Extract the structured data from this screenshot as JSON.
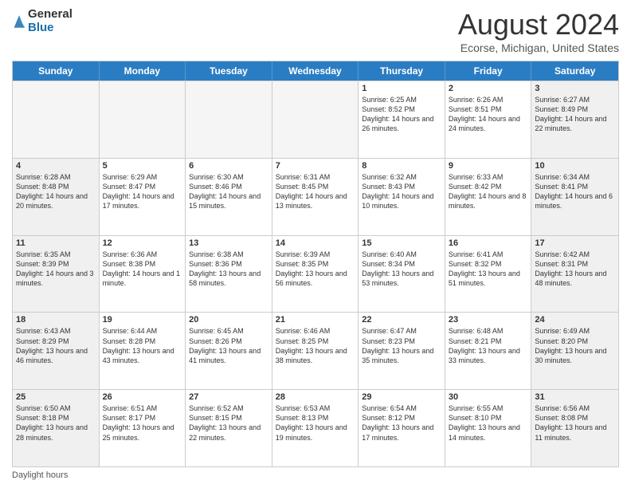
{
  "logo": {
    "general": "General",
    "blue": "Blue"
  },
  "title": "August 2024",
  "location": "Ecorse, Michigan, United States",
  "days_of_week": [
    "Sunday",
    "Monday",
    "Tuesday",
    "Wednesday",
    "Thursday",
    "Friday",
    "Saturday"
  ],
  "footer": "Daylight hours",
  "weeks": [
    [
      {
        "day": "",
        "text": "",
        "empty": true
      },
      {
        "day": "",
        "text": "",
        "empty": true
      },
      {
        "day": "",
        "text": "",
        "empty": true
      },
      {
        "day": "",
        "text": "",
        "empty": true
      },
      {
        "day": "1",
        "text": "Sunrise: 6:25 AM\nSunset: 8:52 PM\nDaylight: 14 hours and 26 minutes.",
        "empty": false
      },
      {
        "day": "2",
        "text": "Sunrise: 6:26 AM\nSunset: 8:51 PM\nDaylight: 14 hours and 24 minutes.",
        "empty": false
      },
      {
        "day": "3",
        "text": "Sunrise: 6:27 AM\nSunset: 8:49 PM\nDaylight: 14 hours and 22 minutes.",
        "empty": false
      }
    ],
    [
      {
        "day": "4",
        "text": "Sunrise: 6:28 AM\nSunset: 8:48 PM\nDaylight: 14 hours and 20 minutes.",
        "empty": false
      },
      {
        "day": "5",
        "text": "Sunrise: 6:29 AM\nSunset: 8:47 PM\nDaylight: 14 hours and 17 minutes.",
        "empty": false
      },
      {
        "day": "6",
        "text": "Sunrise: 6:30 AM\nSunset: 8:46 PM\nDaylight: 14 hours and 15 minutes.",
        "empty": false
      },
      {
        "day": "7",
        "text": "Sunrise: 6:31 AM\nSunset: 8:45 PM\nDaylight: 14 hours and 13 minutes.",
        "empty": false
      },
      {
        "day": "8",
        "text": "Sunrise: 6:32 AM\nSunset: 8:43 PM\nDaylight: 14 hours and 10 minutes.",
        "empty": false
      },
      {
        "day": "9",
        "text": "Sunrise: 6:33 AM\nSunset: 8:42 PM\nDaylight: 14 hours and 8 minutes.",
        "empty": false
      },
      {
        "day": "10",
        "text": "Sunrise: 6:34 AM\nSunset: 8:41 PM\nDaylight: 14 hours and 6 minutes.",
        "empty": false
      }
    ],
    [
      {
        "day": "11",
        "text": "Sunrise: 6:35 AM\nSunset: 8:39 PM\nDaylight: 14 hours and 3 minutes.",
        "empty": false
      },
      {
        "day": "12",
        "text": "Sunrise: 6:36 AM\nSunset: 8:38 PM\nDaylight: 14 hours and 1 minute.",
        "empty": false
      },
      {
        "day": "13",
        "text": "Sunrise: 6:38 AM\nSunset: 8:36 PM\nDaylight: 13 hours and 58 minutes.",
        "empty": false
      },
      {
        "day": "14",
        "text": "Sunrise: 6:39 AM\nSunset: 8:35 PM\nDaylight: 13 hours and 56 minutes.",
        "empty": false
      },
      {
        "day": "15",
        "text": "Sunrise: 6:40 AM\nSunset: 8:34 PM\nDaylight: 13 hours and 53 minutes.",
        "empty": false
      },
      {
        "day": "16",
        "text": "Sunrise: 6:41 AM\nSunset: 8:32 PM\nDaylight: 13 hours and 51 minutes.",
        "empty": false
      },
      {
        "day": "17",
        "text": "Sunrise: 6:42 AM\nSunset: 8:31 PM\nDaylight: 13 hours and 48 minutes.",
        "empty": false
      }
    ],
    [
      {
        "day": "18",
        "text": "Sunrise: 6:43 AM\nSunset: 8:29 PM\nDaylight: 13 hours and 46 minutes.",
        "empty": false
      },
      {
        "day": "19",
        "text": "Sunrise: 6:44 AM\nSunset: 8:28 PM\nDaylight: 13 hours and 43 minutes.",
        "empty": false
      },
      {
        "day": "20",
        "text": "Sunrise: 6:45 AM\nSunset: 8:26 PM\nDaylight: 13 hours and 41 minutes.",
        "empty": false
      },
      {
        "day": "21",
        "text": "Sunrise: 6:46 AM\nSunset: 8:25 PM\nDaylight: 13 hours and 38 minutes.",
        "empty": false
      },
      {
        "day": "22",
        "text": "Sunrise: 6:47 AM\nSunset: 8:23 PM\nDaylight: 13 hours and 35 minutes.",
        "empty": false
      },
      {
        "day": "23",
        "text": "Sunrise: 6:48 AM\nSunset: 8:21 PM\nDaylight: 13 hours and 33 minutes.",
        "empty": false
      },
      {
        "day": "24",
        "text": "Sunrise: 6:49 AM\nSunset: 8:20 PM\nDaylight: 13 hours and 30 minutes.",
        "empty": false
      }
    ],
    [
      {
        "day": "25",
        "text": "Sunrise: 6:50 AM\nSunset: 8:18 PM\nDaylight: 13 hours and 28 minutes.",
        "empty": false
      },
      {
        "day": "26",
        "text": "Sunrise: 6:51 AM\nSunset: 8:17 PM\nDaylight: 13 hours and 25 minutes.",
        "empty": false
      },
      {
        "day": "27",
        "text": "Sunrise: 6:52 AM\nSunset: 8:15 PM\nDaylight: 13 hours and 22 minutes.",
        "empty": false
      },
      {
        "day": "28",
        "text": "Sunrise: 6:53 AM\nSunset: 8:13 PM\nDaylight: 13 hours and 19 minutes.",
        "empty": false
      },
      {
        "day": "29",
        "text": "Sunrise: 6:54 AM\nSunset: 8:12 PM\nDaylight: 13 hours and 17 minutes.",
        "empty": false
      },
      {
        "day": "30",
        "text": "Sunrise: 6:55 AM\nSunset: 8:10 PM\nDaylight: 13 hours and 14 minutes.",
        "empty": false
      },
      {
        "day": "31",
        "text": "Sunrise: 6:56 AM\nSunset: 8:08 PM\nDaylight: 13 hours and 11 minutes.",
        "empty": false
      }
    ]
  ]
}
